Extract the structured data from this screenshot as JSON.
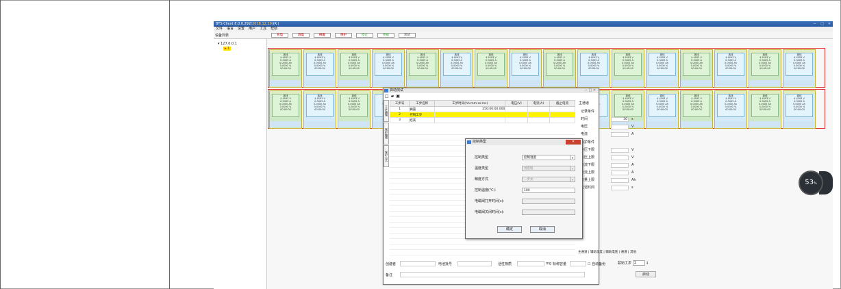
{
  "window": {
    "title_prefix": "BTS Client 8.0.0.292(",
    "title_date": "2018.12.29)",
    "title_suffix": "(R.)"
  },
  "menu": [
    "文件",
    "语言",
    "设置",
    "用户",
    "工具",
    "帮助"
  ],
  "toolbar": {
    "device_list_label": "设备列表",
    "buttons": [
      "充电",
      "放电",
      "搁置",
      "保护",
      "停止",
      "完成",
      "测试"
    ]
  },
  "tree": {
    "ip": "127.0.0.1",
    "node": "1"
  },
  "cells": {
    "status": "离线",
    "voltage": "4.4593 V",
    "current": "0.3405 A",
    "capacity": "0.0000 Ah",
    "percent": "0.0000 %",
    "time": "00:00:00"
  },
  "main_settings": {
    "title": "启动测试",
    "tabs": [
      "工步编辑",
      "保护编辑",
      "保护公式"
    ],
    "columns": [
      "工步号",
      "工步名称",
      "工步时间(hh:mm:ss:ms)",
      "电压(V)",
      "电流(A)",
      "截止电流"
    ],
    "steps": [
      {
        "no": "1",
        "name": "搁置",
        "time": "250:00:00.000"
      },
      {
        "no": "2",
        "name": "控制工步",
        "time": ""
      },
      {
        "no": "3",
        "name": "结束",
        "time": ""
      }
    ],
    "right_panel": {
      "header": "主通道",
      "record_section": "记录条件",
      "time_label": "时间",
      "time_value": "30",
      "time_unit": "s",
      "voltage_label": "电压",
      "voltage_unit": "V",
      "current_label": "电流",
      "current_unit": "A",
      "protect_section": "保护条件",
      "rows": [
        {
          "label": "电压下限",
          "unit": "V"
        },
        {
          "label": "电压上限",
          "unit": "V"
        },
        {
          "label": "电流下限",
          "unit": "A"
        },
        {
          "label": "电流上限",
          "unit": "A"
        },
        {
          "label": "容量上限",
          "unit": "Ah"
        },
        {
          "label": "延迟时间",
          "unit": "s"
        }
      ]
    },
    "bottom_tabs": "主通道 | 辅助温度 | 辅助电压 | 通道 | 其他",
    "bottom": {
      "creator": "创建者",
      "batch": "电池批号",
      "material": "活性物质",
      "mg": "mg",
      "nominal": "标称容量",
      "auto_backup": "自动备份",
      "start_step": "起始工步",
      "start_step_value": "1",
      "remark": "备注",
      "start_button": "启动"
    }
  },
  "dialog": {
    "title": "控制类型",
    "rows": [
      {
        "label": "控制类型",
        "value": "控制温度",
        "disabled": false
      },
      {
        "label": "温度类型",
        "value": "温度值",
        "disabled": true
      },
      {
        "label": "精度方式",
        "value": "一步式",
        "disabled": true
      },
      {
        "label": "控制温度(℃):",
        "value": "100",
        "disabled": false
      },
      {
        "label": "电磁阀打开时间(s):",
        "value": "",
        "disabled": true
      },
      {
        "label": "电磁阀关闭时间(s):",
        "value": "",
        "disabled": true
      }
    ],
    "ok": "确定",
    "cancel": "取消"
  },
  "gauge": {
    "value": "53",
    "unit": "%"
  }
}
